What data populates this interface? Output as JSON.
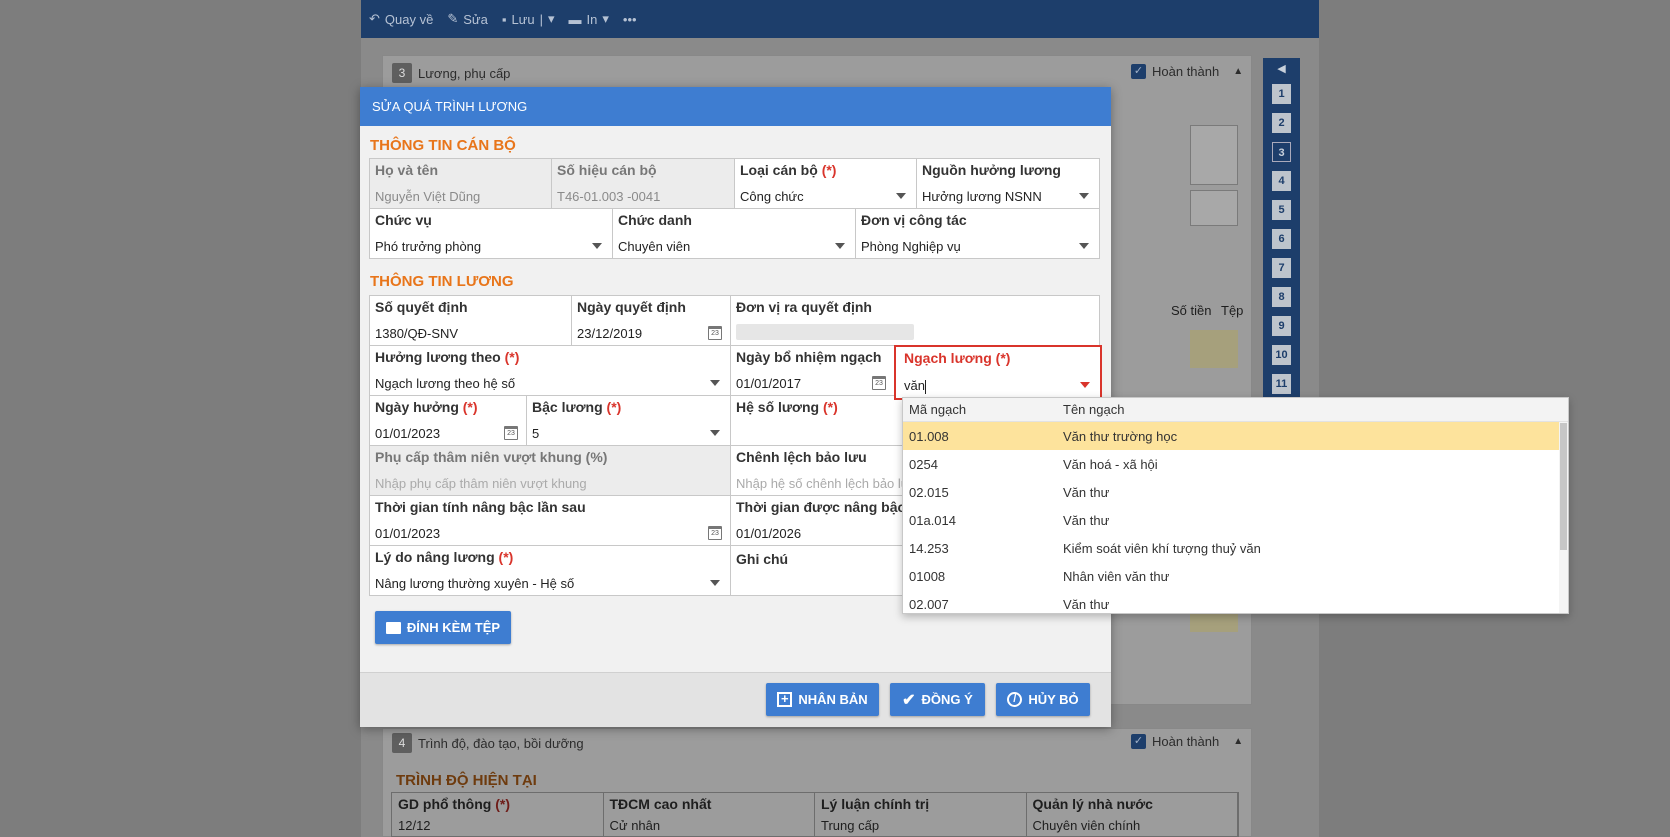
{
  "toolbar": {
    "back": "Quay về",
    "edit": "Sửa",
    "save": "Lưu",
    "print": "In",
    "more": "•••"
  },
  "background": {
    "section3_num": "3",
    "section3_title": "Lương, phụ cấp",
    "section4_num": "4",
    "section4_title": "Trình độ, đào tạo, bồi dưỡng",
    "completed_label": "Hoàn thành",
    "so_tien": "Số tiền",
    "tep": "Tệp",
    "current_level_title": "TRÌNH ĐỘ HIỆN TẠI",
    "grid": [
      {
        "label": "GD phổ thông",
        "req": "(*)",
        "value": "12/12"
      },
      {
        "label": "TĐCM cao nhất",
        "req": "",
        "value": "Cử nhân"
      },
      {
        "label": "Lý luận chính trị",
        "req": "",
        "value": "Trung cấp"
      },
      {
        "label": "Quản lý nhà nước",
        "req": "",
        "value": "Chuyên viên chính"
      }
    ],
    "side_nav": [
      "1",
      "2",
      "3",
      "4",
      "5",
      "6",
      "7",
      "8",
      "9",
      "10",
      "11"
    ]
  },
  "modal": {
    "title": "SỬA QUÁ TRÌNH LƯƠNG",
    "staff_section": "THÔNG TIN CÁN BỘ",
    "salary_section": "THÔNG TIN LƯƠNG",
    "fields": {
      "ho_ten": {
        "label": "Họ và tên",
        "value": "Nguyễn Việt Dũng"
      },
      "so_hieu": {
        "label": "Số hiệu cán bộ",
        "value": "T46-01.003 -0041"
      },
      "loai_can_bo": {
        "label": "Loại cán bộ",
        "req": "(*)",
        "value": "Công chức"
      },
      "nguon_huong": {
        "label": "Nguồn hưởng lương",
        "value": "Hưởng lương NSNN"
      },
      "chuc_vu": {
        "label": "Chức vụ",
        "value": "Phó trưởng phòng"
      },
      "chuc_danh": {
        "label": "Chức danh",
        "value": "Chuyên viên"
      },
      "don_vi": {
        "label": "Đơn vị công tác",
        "value": "Phòng Nghiệp vụ"
      },
      "so_qd": {
        "label": "Số quyết định",
        "value": "1380/QĐ-SNV"
      },
      "ngay_qd": {
        "label": "Ngày quyết định",
        "value": "23/12/2019"
      },
      "don_vi_qd": {
        "label": "Đơn vị ra quyết định"
      },
      "huong_luong_theo": {
        "label": "Hưởng lương theo",
        "req": "(*)",
        "value": "Ngạch lương theo hệ số"
      },
      "ngay_bo_nhiem": {
        "label": "Ngày bổ nhiệm ngạch",
        "value": "01/01/2017"
      },
      "ngach_luong": {
        "label": "Ngạch lương",
        "req": "(*)",
        "value": "văn"
      },
      "ngay_huong": {
        "label": "Ngày hưởng",
        "req": "(*)",
        "value": "01/01/2023"
      },
      "bac_luong": {
        "label": "Bậc lương",
        "req": "(*)",
        "value": "5"
      },
      "he_so": {
        "label": "Hệ số lương",
        "req": "(*)"
      },
      "phu_cap": {
        "label": "Phụ cấp thâm niên vượt khung (%)",
        "placeholder": "Nhập phụ cấp thâm niên vượt khung"
      },
      "chenh_lech": {
        "label": "Chênh lệch bảo lưu",
        "placeholder": "Nhập hệ số chênh lệch bảo lưu"
      },
      "tg_nang_bac": {
        "label": "Thời gian tính nâng bậc lần sau",
        "value": "01/01/2023"
      },
      "tg_duoc_nang": {
        "label": "Thời gian được nâng bậc",
        "value": "01/01/2026"
      },
      "ly_do": {
        "label": "Lý do nâng lương",
        "req": "(*)",
        "value": "Nâng lương thường xuyên - Hệ số"
      },
      "ghi_chu": {
        "label": "Ghi chú"
      }
    },
    "attach_button": "ĐÍNH KÈM TỆP",
    "buttons": {
      "clone": "NHÂN BẢN",
      "ok": "ĐỒNG Ý",
      "cancel": "HỦY BỎ"
    }
  },
  "dropdown": {
    "headers": [
      "Mã ngạch",
      "Tên ngạch"
    ],
    "rows": [
      {
        "code": "01.008",
        "name": "Văn thư trường học",
        "selected": true
      },
      {
        "code": "0254",
        "name": "Văn hoá - xã hội"
      },
      {
        "code": "02.015",
        "name": "Văn thư"
      },
      {
        "code": "01a.014",
        "name": "Văn thư"
      },
      {
        "code": "14.253",
        "name": "Kiểm soát viên khí tượng thuỷ văn"
      },
      {
        "code": "01008",
        "name": "Nhân viên văn thư"
      },
      {
        "code": "02.007",
        "name": "Văn thư"
      }
    ]
  },
  "colors": {
    "accent": "#3e7dd1",
    "section_orange": "#e8751a",
    "required_red": "#d9342b",
    "selected_row": "#fde39c",
    "toolbar": "#1d3e6b"
  }
}
